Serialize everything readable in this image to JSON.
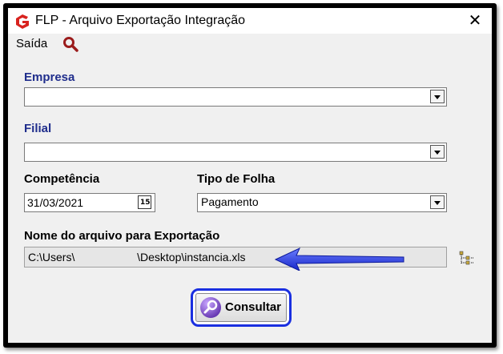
{
  "window": {
    "title": "FLP - Arquivo Exportação Integração",
    "close_glyph": "✕"
  },
  "menu": {
    "saida_label": "Saída",
    "search_icon": "search-icon"
  },
  "fields": {
    "empresa": {
      "label": "Empresa",
      "value": ""
    },
    "filial": {
      "label": "Filial",
      "value": ""
    },
    "competencia": {
      "label": "Competência",
      "value": "31/03/2021",
      "calendar_day": "15"
    },
    "tipo_folha": {
      "label": "Tipo de Folha",
      "value": "Pagamento"
    },
    "arquivo": {
      "label": "Nome do arquivo para Exportação",
      "value": "C:\\Users\\                    \\Desktop\\instancia.xls"
    }
  },
  "actions": {
    "consultar_label": "Consultar"
  },
  "colors": {
    "label_blue": "#1f2d8c",
    "highlight_blue": "#1a2fe0",
    "logo_red": "#d8231f"
  }
}
